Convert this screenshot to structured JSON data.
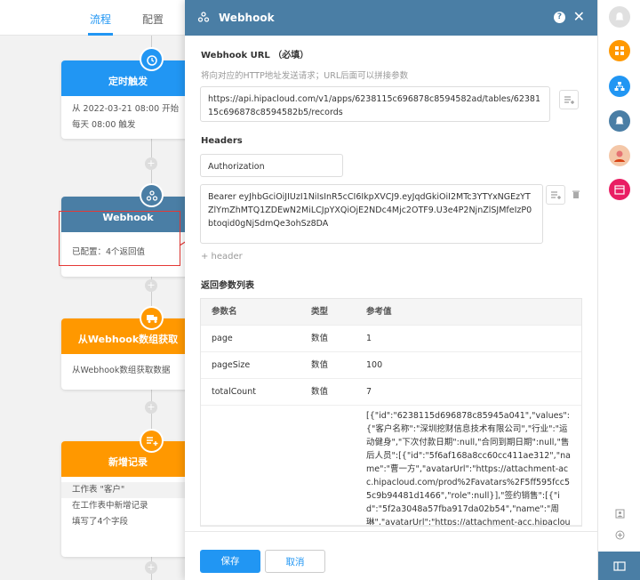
{
  "tabs": [
    {
      "label": "流程"
    },
    {
      "label": "配置"
    }
  ],
  "nodes": {
    "timer": {
      "title": "定时触发",
      "line1": "从 2022-03-21 08:00 开始",
      "line2": "每天 08:00 触发",
      "color": "#2196f3"
    },
    "webhook": {
      "title": "Webhook",
      "line1": "已配置：4个返回值",
      "color": "#4a7ea5"
    },
    "fetch": {
      "title": "从Webhook数组获取",
      "line1": "从Webhook数组获取数据",
      "color": "#ff9800"
    },
    "add": {
      "title": "新增记录",
      "line1": "工作表 \"客户\"",
      "line2": "在工作表中新增记录",
      "line3": "填写了4个字段",
      "color": "#ff9800"
    }
  },
  "dialog": {
    "title": "Webhook",
    "close": "✕",
    "help": "?",
    "url_label": "Webhook URL （必填）",
    "url_hint": "将向对应的HTTP地址发送请求；URL后面可以拼接参数",
    "url_value": "https://api.hipacloud.com/v1/apps/6238115c696878c8594582ad/tables/6238115c696878c8594582b5/records",
    "headers_label": "Headers",
    "header_key": "Authorization",
    "header_value": "Bearer eyJhbGciOiJIUzI1NiIsInR5cCI6IkpXVCJ9.eyJqdGkiOiI2MTc3YTYxNGEzYTZlYmZhMTQ1ZDEwN2MiLCJpYXQiOjE2NDc4Mjc2OTF9.U3e4P2NjnZlSJMfeIzP0btoqid0gNjSdmQe3ohSz8DA",
    "add_header": "+ header",
    "return_label": "返回参数列表",
    "table": {
      "headers": [
        "参数名",
        "类型",
        "参考值"
      ],
      "rows": [
        [
          "page",
          "数值",
          "1"
        ],
        [
          "pageSize",
          "数值",
          "100"
        ],
        [
          "totalCount",
          "数值",
          "7"
        ],
        [
          "",
          "",
          "[{\"id\":\"6238115d696878c85945a041\",\"values\":{\"客户名称\":\"深圳挖财信息技术有限公司\",\"行业\":\"运动健身\",\"下次付款日期\":null,\"合同到期日期\":null,\"售后人员\":[{\"id\":\"5f6af168a8cc60cc411ae312\",\"name\":\"曹一方\",\"avatarUrl\":\"https://attachment-acc.hipacloud.com/prod%2Favatars%2F5ff595fcc55c9b94481d1466\",\"role\":null}],\"签约销售\":[{\"id\":\"5f2a3048a57fba917da02b54\",\"name\":\"周琳\",\"avatarUrl\":\"https://attachment-acc.hipacloud.com/prod%2Favatars%2F603f31be9f4f3177a9a5070"
        ]
      ]
    },
    "save": "保存",
    "cancel": "取消"
  },
  "rail_colors": {
    "orange": "#ff9800",
    "blue": "#2196f3",
    "slate": "#4a7ea5",
    "red": "#e91e63",
    "bell_gray": "#e0e0e0"
  }
}
